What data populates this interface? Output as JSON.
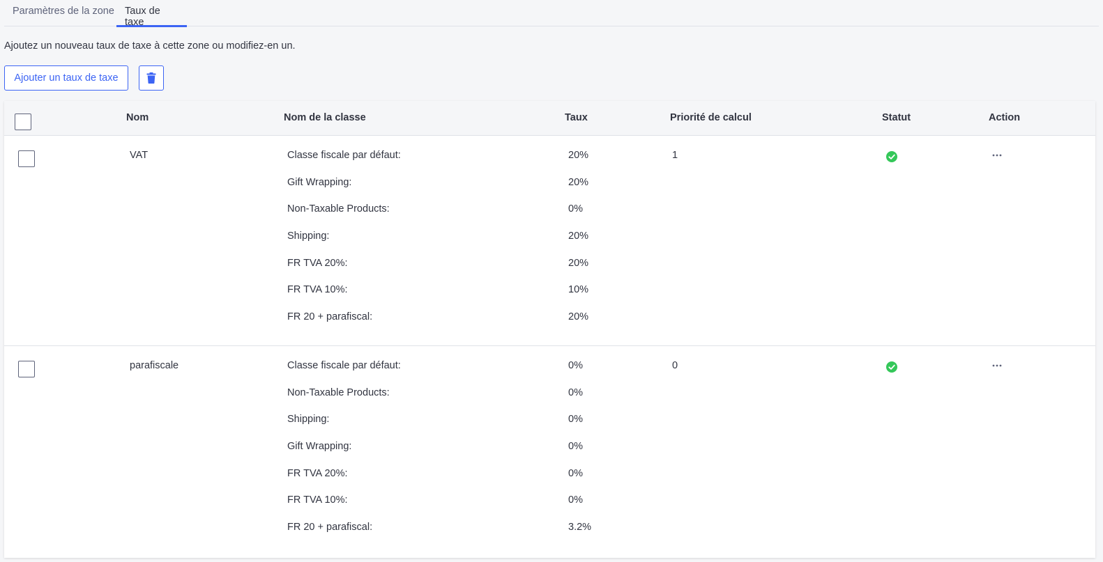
{
  "tabs": [
    {
      "label": "Paramètres de la zone"
    },
    {
      "label": "Taux de taxe"
    }
  ],
  "intro": "Ajoutez un nouveau taux de taxe à cette zone ou modifiez-en un.",
  "toolbar": {
    "add_label": "Ajouter un taux de taxe",
    "delete_icon": "trash-icon"
  },
  "colors": {
    "accent": "#3c64f4",
    "status_enabled": "#34c759",
    "text": "#313440",
    "muted": "#5e637a"
  },
  "table": {
    "headers": {
      "name": "Nom",
      "class_name": "Nom de la classe",
      "rate": "Taux",
      "priority": "Priorité de calcul",
      "status": "Statut",
      "action": "Action"
    },
    "rows": [
      {
        "name": "VAT",
        "priority": "1",
        "status": "enabled",
        "classes": [
          {
            "label": "Classe fiscale par défaut:",
            "rate": "20%"
          },
          {
            "label": "Gift Wrapping:",
            "rate": "20%"
          },
          {
            "label": "Non-Taxable Products:",
            "rate": "0%"
          },
          {
            "label": "Shipping:",
            "rate": "20%"
          },
          {
            "label": "FR TVA 20%:",
            "rate": "20%"
          },
          {
            "label": "FR TVA 10%:",
            "rate": "10%"
          },
          {
            "label": "FR 20 + parafiscal:",
            "rate": "20%"
          }
        ]
      },
      {
        "name": "parafiscale",
        "priority": "0",
        "status": "enabled",
        "classes": [
          {
            "label": "Classe fiscale par défaut:",
            "rate": "0%"
          },
          {
            "label": "Non-Taxable Products:",
            "rate": "0%"
          },
          {
            "label": "Shipping:",
            "rate": "0%"
          },
          {
            "label": "Gift Wrapping:",
            "rate": "0%"
          },
          {
            "label": "FR TVA 20%:",
            "rate": "0%"
          },
          {
            "label": "FR TVA 10%:",
            "rate": "0%"
          },
          {
            "label": "FR 20 + parafiscal:",
            "rate": "3.2%"
          }
        ]
      }
    ]
  }
}
